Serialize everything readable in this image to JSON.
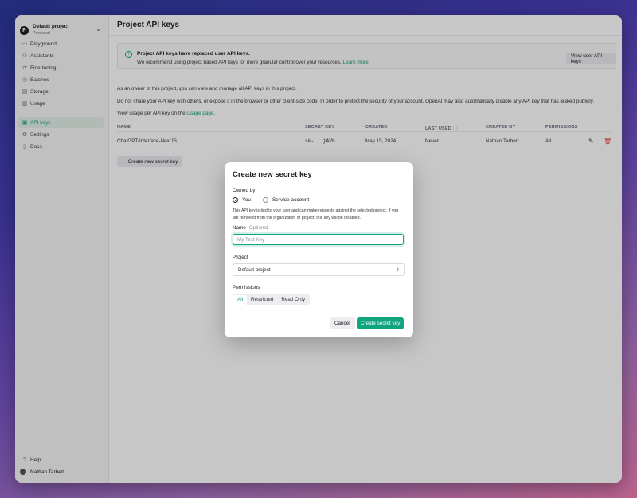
{
  "project_switcher": {
    "avatar": "P",
    "name": "Default project",
    "sub": "Personal"
  },
  "sidebar": {
    "items": [
      {
        "label": "Playground",
        "icon": "playground-icon"
      },
      {
        "label": "Assistants",
        "icon": "assistants-icon"
      },
      {
        "label": "Fine-tuning",
        "icon": "fine-tuning-icon"
      },
      {
        "label": "Batches",
        "icon": "batches-icon"
      },
      {
        "label": "Storage",
        "icon": "storage-icon"
      },
      {
        "label": "Usage",
        "icon": "usage-icon"
      },
      {
        "label": "API keys",
        "icon": "key-icon",
        "active": true
      },
      {
        "label": "Settings",
        "icon": "gear-icon"
      },
      {
        "label": "Docs",
        "icon": "docs-icon"
      }
    ],
    "help": "Help",
    "user": "Nathan Tarbert"
  },
  "main": {
    "title": "Project API keys",
    "banner": {
      "title": "Project API keys have replaced user API keys.",
      "text": "We recommend using project based API keys for more granular control over your resources.",
      "link": "Learn more",
      "button": "View user API keys"
    },
    "para1": "As an owner of this project, you can view and manage all API keys in this project.",
    "para2": "Do not share your API key with others, or expose it in the browser or other client-side code. In order to protect the security of your account, OpenAI may also automatically disable any API key that has leaked publicly.",
    "para3_prefix": "View usage per API key on the",
    "para3_link": "Usage page",
    "para3_suffix": ".",
    "columns": [
      "NAME",
      "SECRET KEY",
      "CREATED",
      "LAST USED",
      "CREATED BY",
      "PERMISSIONS"
    ],
    "rows": [
      {
        "name": "ChatGPT-Interface-NextJS",
        "secret": "sk-...jAVh",
        "created": "May 15, 2024",
        "last_used": "Never",
        "created_by": "Nathan Tarbert",
        "permissions": "All"
      }
    ],
    "create_button": "Create new secret key"
  },
  "modal": {
    "title": "Create new secret key",
    "owned_by_label": "Owned by",
    "owner_options": [
      "You",
      "Service account"
    ],
    "selected_owner": "You",
    "note": "This API key is tied to your user and can make requests against the selected project. If you are removed from the organization or project, this key will be disabled.",
    "name_label": "Name",
    "name_optional": "Optional",
    "name_placeholder": "My Test Key",
    "project_label": "Project",
    "project_value": "Default project",
    "permissions_label": "Permissions",
    "permissions_options": [
      "All",
      "Restricted",
      "Read Only"
    ],
    "permissions_selected": "All",
    "cancel": "Cancel",
    "submit": "Create secret key"
  },
  "colors": {
    "accent": "#10a37f",
    "danger": "#ef4146"
  }
}
